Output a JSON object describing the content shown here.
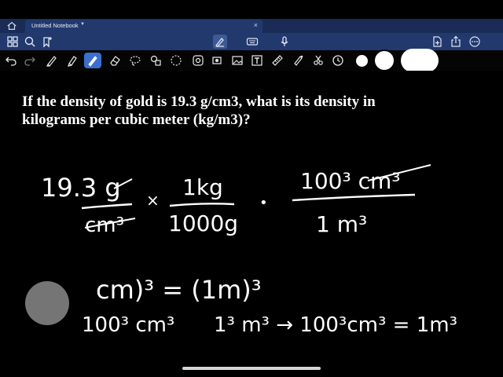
{
  "tab": {
    "title": "Untitled Notebook",
    "close": "×"
  },
  "icons": {
    "toolbar": [
      "home-icon",
      "grid-icon",
      "search-icon",
      "bookmark-plus-icon",
      "pen-nib-icon",
      "keyboard-icon",
      "microphone-icon",
      "add-page-icon",
      "share-icon",
      "more-icon"
    ],
    "drawing": [
      "undo-icon",
      "redo-icon",
      "pen-icon",
      "highlighter-icon",
      "eraser-icon",
      "lasso-icon",
      "shapes-icon",
      "image-icon",
      "text-icon",
      "sticker-icon",
      "laser-pointer-icon",
      "timer-icon"
    ]
  },
  "colors": {
    "tab_bar": "#1a2c55",
    "toolbar": "#22396e",
    "selected_tool": "#3a6fd0",
    "canvas": "#000000",
    "ink": "#ffffff"
  },
  "canvas": {
    "question_line1": "If the density of gold is 19.3 g/cm3, what is its density in",
    "question_line2": "kilograms per cubic meter (kg/m3)?"
  },
  "handwriting": {
    "term1_num": "19.3 g",
    "term1_den": "cm³",
    "times": "×",
    "term2_num": "1kg",
    "term2_den": "1000g",
    "dot": "•",
    "term3_num": "100³ cm³",
    "term3_den": "1 m³",
    "line2": "cm)³ = (1m)³",
    "line3_left": "100³ cm³",
    "line3_right": "1³ m³ → 100³cm³ = 1m³"
  }
}
